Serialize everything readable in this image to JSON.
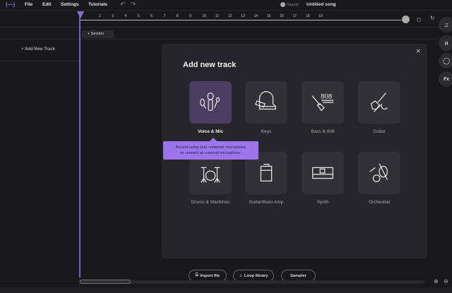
{
  "topbar": {
    "menu": [
      "File",
      "Edit",
      "Settings",
      "Tutorials"
    ],
    "saved": "Saved!",
    "song_title": "Untitled song"
  },
  "ruler": {
    "ticks": [
      "2",
      "3",
      "4",
      "5",
      "6",
      "7",
      "8",
      "9",
      "10",
      "11",
      "12",
      "13",
      "14",
      "15",
      "16",
      "17",
      "18",
      "19"
    ]
  },
  "left": {
    "add_track": "+ Add New Track",
    "section": "+ Section"
  },
  "modal": {
    "title": "Add new track",
    "tracks": [
      "Voice & Mic",
      "Keys",
      "Bass & 808",
      "Guitar",
      "Drums & Machines",
      "Guitar/Bass Amp",
      "Synth",
      "Orchestral"
    ],
    "bass_808_icon_text": "808",
    "buttons": {
      "import": "Import file",
      "loop": "Loop library",
      "sampler": "Sampler"
    },
    "tooltip_line1": "Record using your computer microphone",
    "tooltip_line2": "or connect an external microphone.",
    "accent": "#9d74ea"
  },
  "right": {
    "fx": "Fx"
  }
}
